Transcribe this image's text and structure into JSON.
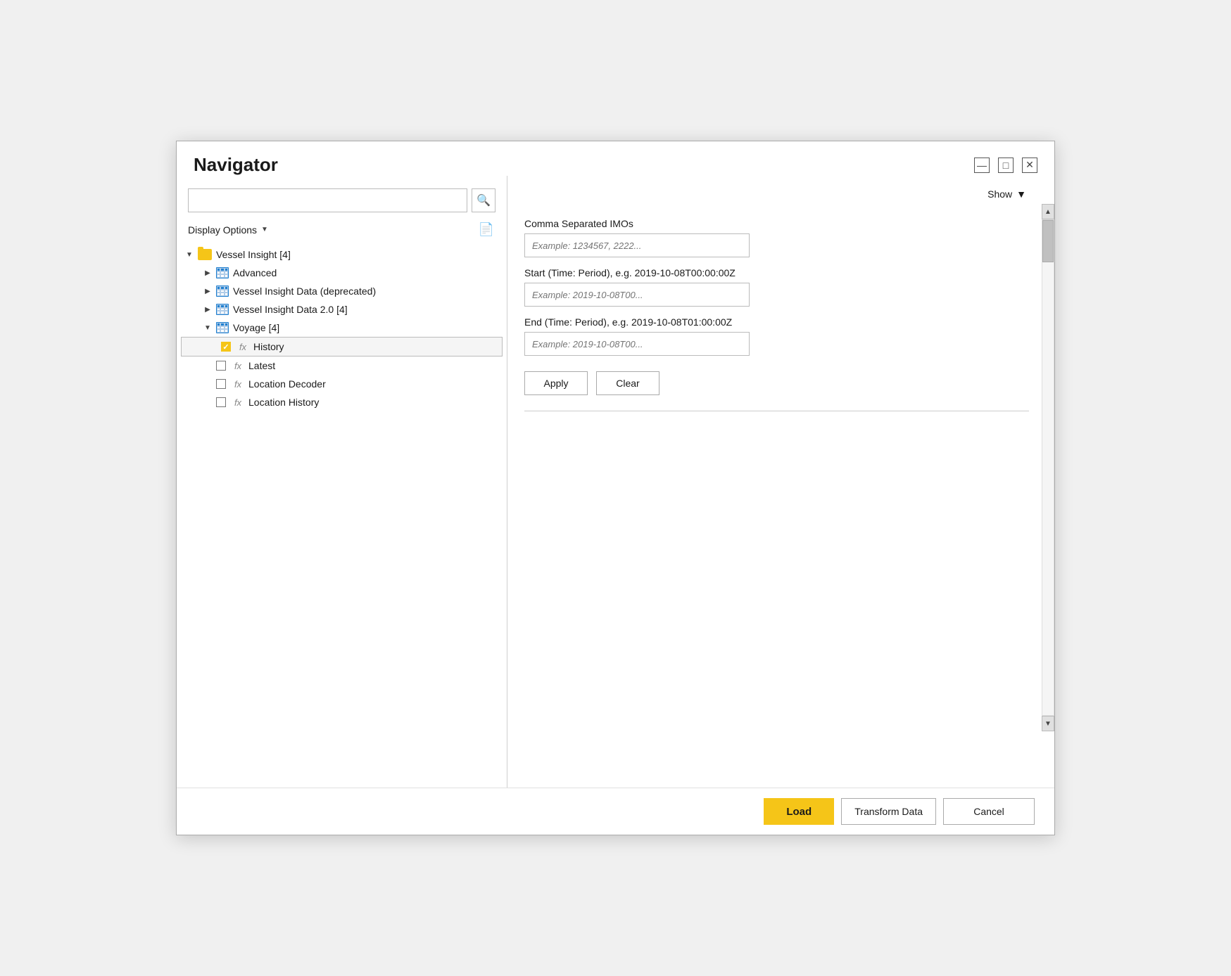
{
  "window": {
    "title": "Navigator",
    "controls": {
      "minimize": "—",
      "maximize": "□",
      "close": "✕"
    }
  },
  "left_panel": {
    "search": {
      "placeholder": "",
      "icon": "🔍"
    },
    "display_options": {
      "label": "Display Options",
      "arrow": "▼",
      "export_icon": "📄"
    },
    "tree": [
      {
        "id": "vessel-insight",
        "label": "Vessel Insight [4]",
        "type": "folder",
        "expanded": true,
        "indent": 0,
        "children": [
          {
            "id": "advanced",
            "label": "Advanced",
            "type": "table",
            "expanded": false,
            "indent": 1,
            "children": []
          },
          {
            "id": "vessel-insight-data-deprecated",
            "label": "Vessel Insight Data (deprecated)",
            "type": "table",
            "expanded": false,
            "indent": 1,
            "children": []
          },
          {
            "id": "vessel-insight-data-20",
            "label": "Vessel Insight Data 2.0 [4]",
            "type": "table",
            "expanded": false,
            "indent": 1,
            "children": []
          },
          {
            "id": "voyage",
            "label": "Voyage [4]",
            "type": "table",
            "expanded": true,
            "indent": 1,
            "children": [
              {
                "id": "history",
                "label": "History",
                "type": "fx",
                "checked": true,
                "selected": true,
                "indent": 2
              },
              {
                "id": "latest",
                "label": "Latest",
                "type": "fx",
                "checked": false,
                "selected": false,
                "indent": 2
              },
              {
                "id": "location-decoder",
                "label": "Location Decoder",
                "type": "fx",
                "checked": false,
                "selected": false,
                "indent": 2
              },
              {
                "id": "location-history",
                "label": "Location History",
                "type": "fx",
                "checked": false,
                "selected": false,
                "indent": 2
              }
            ]
          }
        ]
      }
    ]
  },
  "right_panel": {
    "show_label": "Show",
    "fields": [
      {
        "id": "imos",
        "label": "Comma Separated IMOs",
        "placeholder": "Example: 1234567, 2222..."
      },
      {
        "id": "start",
        "label": "Start (Time: Period), e.g. 2019-10-08T00:00:00Z",
        "placeholder": "Example: 2019-10-08T00..."
      },
      {
        "id": "end",
        "label": "End (Time: Period), e.g. 2019-10-08T01:00:00Z",
        "placeholder": "Example: 2019-10-08T00..."
      }
    ],
    "apply_label": "Apply",
    "clear_label": "Clear"
  },
  "bottom_bar": {
    "load_label": "Load",
    "transform_label": "Transform Data",
    "cancel_label": "Cancel"
  }
}
